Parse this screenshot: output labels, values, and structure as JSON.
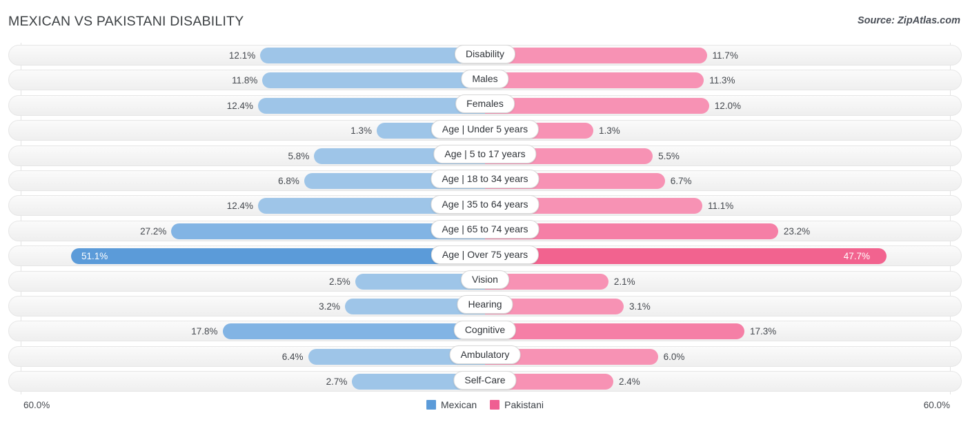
{
  "header": {
    "title": "MEXICAN VS PAKISTANI DISABILITY",
    "source": "Source: ZipAtlas.com"
  },
  "axis": {
    "left_label": "60.0%",
    "right_label": "60.0%",
    "max": 60.0
  },
  "legend": {
    "items": [
      {
        "label": "Mexican",
        "color": "#5b9bd9"
      },
      {
        "label": "Pakistani",
        "color": "#ef5f92"
      }
    ]
  },
  "colors": {
    "mexican_light": "#9ec5e8",
    "mexican_mid": "#82b4e4",
    "mexican_dark": "#5b9bd9",
    "pakistani_light": "#f792b4",
    "pakistani_mid": "#f57fa6",
    "pakistani_dark": "#f2638f",
    "track": "#f4f4f4",
    "gridline": "#e3e3e3"
  },
  "chart_data": {
    "type": "bar",
    "title": "MEXICAN VS PAKISTANI DISABILITY",
    "subtitle": "Source: ZipAtlas.com",
    "orientation": "horizontal-diverging",
    "xlabel": "",
    "ylabel": "",
    "xlim": [
      60.0,
      60.0
    ],
    "grid": true,
    "legend_position": "bottom-center",
    "categories": [
      "Disability",
      "Males",
      "Females",
      "Age | Under 5 years",
      "Age | 5 to 17 years",
      "Age | 18 to 34 years",
      "Age | 35 to 64 years",
      "Age | 65 to 74 years",
      "Age | Over 75 years",
      "Vision",
      "Hearing",
      "Cognitive",
      "Ambulatory",
      "Self-Care"
    ],
    "series": [
      {
        "name": "Mexican",
        "color": "#5b9bd9",
        "values": [
          12.1,
          11.8,
          12.4,
          1.3,
          5.8,
          6.8,
          12.4,
          27.2,
          51.1,
          2.5,
          3.2,
          17.8,
          6.4,
          2.7
        ]
      },
      {
        "name": "Pakistani",
        "color": "#ef5f92",
        "values": [
          11.7,
          11.3,
          12.0,
          1.3,
          5.5,
          6.7,
          11.1,
          23.2,
          47.7,
          2.1,
          3.1,
          17.3,
          6.0,
          2.4
        ]
      }
    ]
  },
  "rows": [
    {
      "label": "Disability",
      "left_value": "12.1%",
      "right_value": "11.7%",
      "left_num": 12.1,
      "right_num": 11.7,
      "shade": "light",
      "inside": false
    },
    {
      "label": "Males",
      "left_value": "11.8%",
      "right_value": "11.3%",
      "left_num": 11.8,
      "right_num": 11.3,
      "shade": "light",
      "inside": false
    },
    {
      "label": "Females",
      "left_value": "12.4%",
      "right_value": "12.0%",
      "left_num": 12.4,
      "right_num": 12.0,
      "shade": "light",
      "inside": false
    },
    {
      "label": "Age | Under 5 years",
      "left_value": "1.3%",
      "right_value": "1.3%",
      "left_num": 1.3,
      "right_num": 1.3,
      "shade": "light",
      "inside": false
    },
    {
      "label": "Age | 5 to 17 years",
      "left_value": "5.8%",
      "right_value": "5.5%",
      "left_num": 5.8,
      "right_num": 5.5,
      "shade": "light",
      "inside": false
    },
    {
      "label": "Age | 18 to 34 years",
      "left_value": "6.8%",
      "right_value": "6.7%",
      "left_num": 6.8,
      "right_num": 6.7,
      "shade": "light",
      "inside": false
    },
    {
      "label": "Age | 35 to 64 years",
      "left_value": "12.4%",
      "right_value": "11.1%",
      "left_num": 12.4,
      "right_num": 11.1,
      "shade": "light",
      "inside": false
    },
    {
      "label": "Age | 65 to 74 years",
      "left_value": "27.2%",
      "right_value": "23.2%",
      "left_num": 27.2,
      "right_num": 23.2,
      "shade": "mid",
      "inside": false
    },
    {
      "label": "Age | Over 75 years",
      "left_value": "51.1%",
      "right_value": "47.7%",
      "left_num": 51.1,
      "right_num": 47.7,
      "shade": "dark",
      "inside": true
    },
    {
      "label": "Vision",
      "left_value": "2.5%",
      "right_value": "2.1%",
      "left_num": 2.5,
      "right_num": 2.1,
      "shade": "light",
      "inside": false
    },
    {
      "label": "Hearing",
      "left_value": "3.2%",
      "right_value": "3.1%",
      "left_num": 3.2,
      "right_num": 3.1,
      "shade": "light",
      "inside": false
    },
    {
      "label": "Cognitive",
      "left_value": "17.8%",
      "right_value": "17.3%",
      "left_num": 17.8,
      "right_num": 17.3,
      "shade": "mid",
      "inside": false
    },
    {
      "label": "Ambulatory",
      "left_value": "6.4%",
      "right_value": "6.0%",
      "left_num": 6.4,
      "right_num": 6.0,
      "shade": "light",
      "inside": false
    },
    {
      "label": "Self-Care",
      "left_value": "2.7%",
      "right_value": "2.4%",
      "left_num": 2.7,
      "right_num": 2.4,
      "shade": "light",
      "inside": false
    }
  ]
}
